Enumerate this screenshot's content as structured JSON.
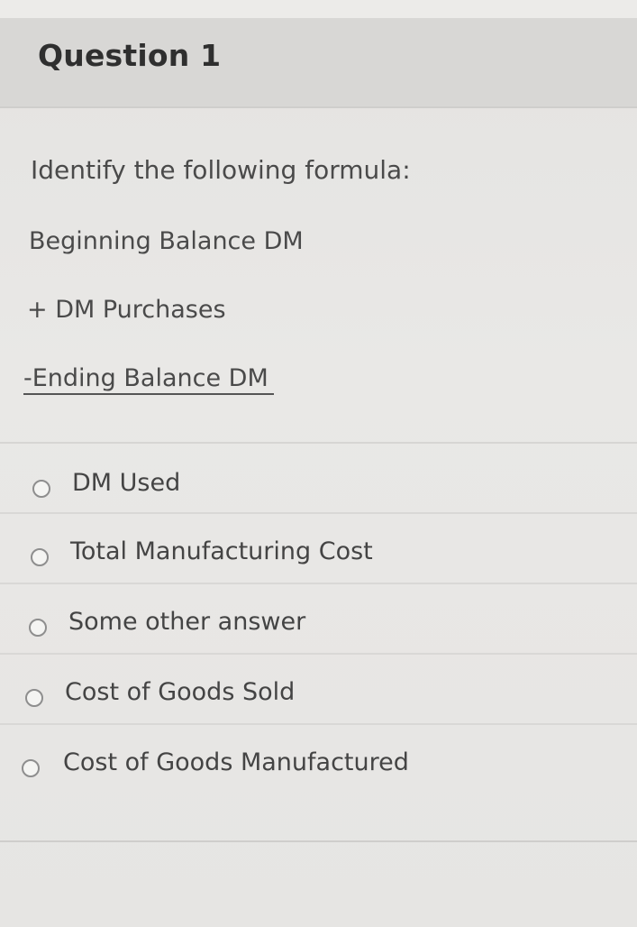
{
  "question": {
    "title": "Question 1",
    "prompt": "Identify the following formula:",
    "formula": {
      "line1": "Beginning Balance DM",
      "line2": "+ DM Purchases",
      "line3": "-Ending Balance DM"
    },
    "options": [
      {
        "label": "DM Used",
        "selected": false
      },
      {
        "label": "Total Manufacturing Cost",
        "selected": false
      },
      {
        "label": "Some other answer",
        "selected": false
      },
      {
        "label": "Cost of Goods Sold",
        "selected": false
      },
      {
        "label": "Cost of Goods Manufactured",
        "selected": false
      }
    ]
  },
  "colors": {
    "header_bg": "#d8d7d5",
    "page_bg": "#e8e7e5",
    "text": "#444444",
    "radio_border": "#8e8e8e"
  }
}
